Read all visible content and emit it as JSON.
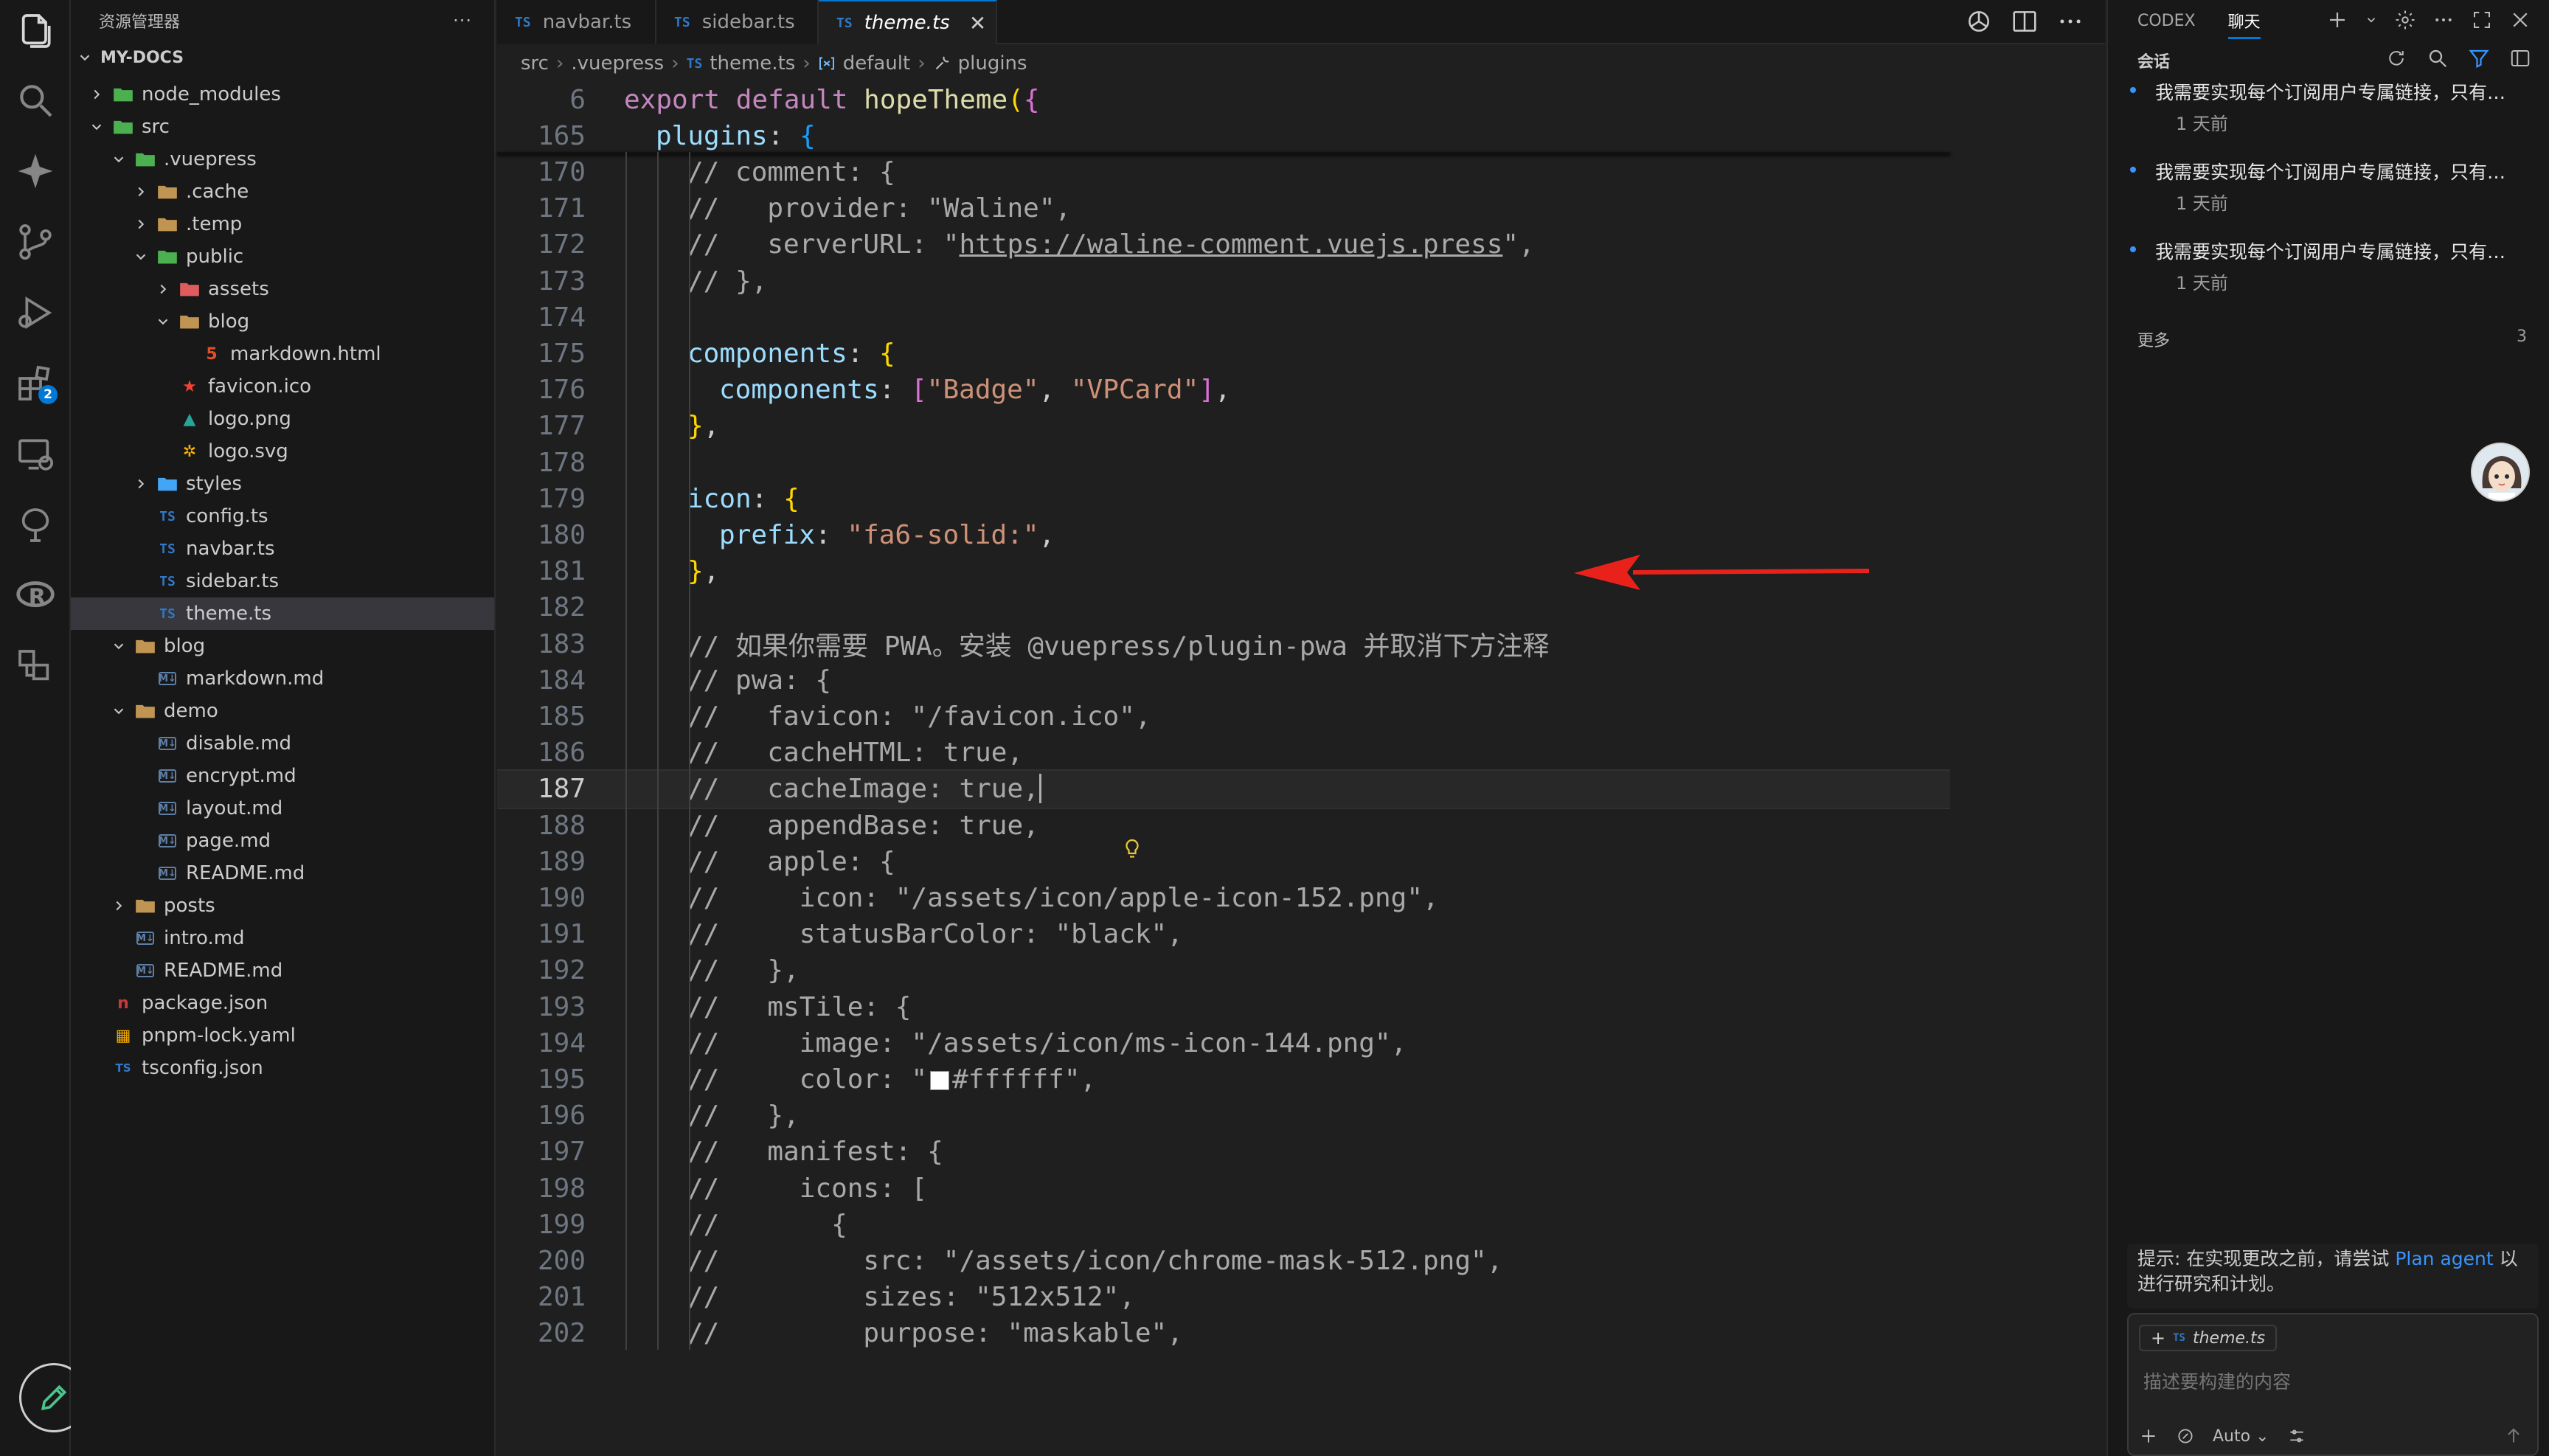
{
  "explorer": {
    "title": "资源管理器",
    "more": "···",
    "root": "MY-DOCS",
    "tree": [
      {
        "label": "node_modules",
        "type": "folder",
        "icon": "folder-green-icon",
        "depth": 0,
        "open": false
      },
      {
        "label": "src",
        "type": "folder",
        "icon": "folder-green-icon",
        "depth": 0,
        "open": true
      },
      {
        "label": ".vuepress",
        "type": "folder",
        "icon": "folder-green-icon",
        "depth": 1,
        "open": true
      },
      {
        "label": ".cache",
        "type": "folder",
        "icon": "folder-icon",
        "depth": 2,
        "open": false
      },
      {
        "label": ".temp",
        "type": "folder",
        "icon": "folder-icon",
        "depth": 2,
        "open": false
      },
      {
        "label": "public",
        "type": "folder",
        "icon": "folder-green-icon",
        "depth": 2,
        "open": true
      },
      {
        "label": "assets",
        "type": "folder",
        "icon": "folder-red-icon",
        "depth": 3,
        "open": false
      },
      {
        "label": "blog",
        "type": "folder",
        "icon": "folder-icon",
        "depth": 3,
        "open": true
      },
      {
        "label": "markdown.html",
        "type": "file",
        "icon": "html5-icon",
        "depth": 4
      },
      {
        "label": "favicon.ico",
        "type": "file",
        "icon": "star-file-icon",
        "depth": 3
      },
      {
        "label": "logo.png",
        "type": "file",
        "icon": "image-file-icon",
        "depth": 3
      },
      {
        "label": "logo.svg",
        "type": "file",
        "icon": "svg-file-icon",
        "depth": 3
      },
      {
        "label": "styles",
        "type": "folder",
        "icon": "folder-blue-icon",
        "depth": 2,
        "open": false
      },
      {
        "label": "config.ts",
        "type": "file",
        "icon": "typescript-icon",
        "depth": 2
      },
      {
        "label": "navbar.ts",
        "type": "file",
        "icon": "typescript-icon",
        "depth": 2
      },
      {
        "label": "sidebar.ts",
        "type": "file",
        "icon": "typescript-icon",
        "depth": 2
      },
      {
        "label": "theme.ts",
        "type": "file",
        "icon": "typescript-icon",
        "depth": 2,
        "selected": true
      },
      {
        "label": "blog",
        "type": "folder",
        "icon": "folder-icon",
        "depth": 1,
        "open": true
      },
      {
        "label": "markdown.md",
        "type": "file",
        "icon": "markdown-icon",
        "depth": 2
      },
      {
        "label": "demo",
        "type": "folder",
        "icon": "folder-icon",
        "depth": 1,
        "open": true
      },
      {
        "label": "disable.md",
        "type": "file",
        "icon": "markdown-icon",
        "depth": 2
      },
      {
        "label": "encrypt.md",
        "type": "file",
        "icon": "markdown-icon",
        "depth": 2
      },
      {
        "label": "layout.md",
        "type": "file",
        "icon": "markdown-icon",
        "depth": 2
      },
      {
        "label": "page.md",
        "type": "file",
        "icon": "markdown-icon",
        "depth": 2
      },
      {
        "label": "README.md",
        "type": "file",
        "icon": "markdown-icon",
        "depth": 2
      },
      {
        "label": "posts",
        "type": "folder",
        "icon": "folder-icon",
        "depth": 1,
        "open": false
      },
      {
        "label": "intro.md",
        "type": "file",
        "icon": "markdown-icon",
        "depth": 1
      },
      {
        "label": "README.md",
        "type": "file",
        "icon": "markdown-icon",
        "depth": 1
      },
      {
        "label": "package.json",
        "type": "file",
        "icon": "npm-icon",
        "depth": 0
      },
      {
        "label": "pnpm-lock.yaml",
        "type": "file",
        "icon": "pnpm-icon",
        "depth": 0
      },
      {
        "label": "tsconfig.json",
        "type": "file",
        "icon": "tsconfig-icon",
        "depth": 0
      }
    ]
  },
  "activity": {
    "items": [
      "files-icon",
      "search-icon",
      "sparkle-icon",
      "source-control-icon",
      "run-debug-icon",
      "extensions-icon",
      "remote-explorer-icon",
      "tree-icon",
      "r-language-icon",
      "containers-icon"
    ],
    "extensions_badge": "2",
    "bottom": "edit-pencil-icon"
  },
  "tabs": [
    {
      "label": "navbar.ts",
      "badge": "TS",
      "active": false
    },
    {
      "label": "sidebar.ts",
      "badge": "TS",
      "active": false
    },
    {
      "label": "theme.ts",
      "badge": "TS",
      "active": true,
      "close": "✕"
    }
  ],
  "breadcrumb": {
    "parts": [
      "src",
      ".vuepress",
      "theme.ts",
      "default",
      "plugins"
    ],
    "ts_badge": "TS",
    "sep": "›"
  },
  "editor": {
    "current_line": "187",
    "lines": [
      {
        "n": "6",
        "indent": 0,
        "sticky": true,
        "segs": [
          [
            "kw",
            "export"
          ],
          [
            "",
            " "
          ],
          [
            "kw",
            "default"
          ],
          [
            "",
            " "
          ],
          [
            "fn",
            "hopeTheme"
          ],
          [
            "br1",
            "("
          ],
          [
            "br2",
            "{"
          ]
        ]
      },
      {
        "n": "165",
        "indent": 1,
        "sticky": true,
        "segs": [
          [
            "pr",
            "plugins"
          ],
          [
            "",
            ": "
          ],
          [
            "br3",
            "{"
          ]
        ]
      },
      {
        "n": "170",
        "indent": 2,
        "segs": [
          [
            "cm",
            "// comment: {"
          ]
        ]
      },
      {
        "n": "171",
        "indent": 2,
        "segs": [
          [
            "cm",
            "//   provider: \"Waline\","
          ]
        ]
      },
      {
        "n": "172",
        "indent": 2,
        "segs": [
          [
            "cm",
            "//   serverURL: \""
          ],
          [
            "cm u",
            "https://waline-comment.vuejs.press"
          ],
          [
            "cm",
            "\","
          ]
        ]
      },
      {
        "n": "173",
        "indent": 2,
        "segs": [
          [
            "cm",
            "// },"
          ]
        ]
      },
      {
        "n": "174",
        "indent": 2,
        "segs": []
      },
      {
        "n": "175",
        "indent": 2,
        "segs": [
          [
            "pr",
            "components"
          ],
          [
            "",
            ": "
          ],
          [
            "br1",
            "{"
          ]
        ]
      },
      {
        "n": "176",
        "indent": 3,
        "segs": [
          [
            "pr",
            "components"
          ],
          [
            "",
            ": "
          ],
          [
            "br2",
            "["
          ],
          [
            "st",
            "\"Badge\""
          ],
          [
            "",
            ", "
          ],
          [
            "st",
            "\"VPCard\""
          ],
          [
            "br2",
            "]"
          ],
          [
            "",
            ","
          ]
        ]
      },
      {
        "n": "177",
        "indent": 2,
        "segs": [
          [
            "br1",
            "}"
          ],
          [
            "",
            ","
          ]
        ]
      },
      {
        "n": "178",
        "indent": 2,
        "segs": []
      },
      {
        "n": "179",
        "indent": 2,
        "segs": [
          [
            "pr",
            "icon"
          ],
          [
            "",
            ": "
          ],
          [
            "br1",
            "{"
          ]
        ]
      },
      {
        "n": "180",
        "indent": 3,
        "segs": [
          [
            "pr",
            "prefix"
          ],
          [
            "",
            ": "
          ],
          [
            "st",
            "\"fa6-solid:\""
          ],
          [
            "",
            ","
          ]
        ]
      },
      {
        "n": "181",
        "indent": 2,
        "segs": [
          [
            "br1",
            "}"
          ],
          [
            "",
            ","
          ]
        ]
      },
      {
        "n": "182",
        "indent": 2,
        "segs": []
      },
      {
        "n": "183",
        "indent": 2,
        "segs": [
          [
            "cm",
            "// 如果你需要 PWA。安装 @vuepress/plugin-pwa 并取消下方注释"
          ]
        ]
      },
      {
        "n": "184",
        "indent": 2,
        "segs": [
          [
            "cm",
            "// pwa: {"
          ]
        ]
      },
      {
        "n": "185",
        "indent": 2,
        "segs": [
          [
            "cm",
            "//   favicon: \"/favicon.ico\","
          ]
        ]
      },
      {
        "n": "186",
        "indent": 2,
        "segs": [
          [
            "cm",
            "//   cacheHTML: true,"
          ]
        ]
      },
      {
        "n": "187",
        "indent": 2,
        "segs": [
          [
            "cm",
            "//   cacheImage: true,"
          ]
        ]
      },
      {
        "n": "188",
        "indent": 2,
        "segs": [
          [
            "cm",
            "//   appendBase: true,"
          ]
        ]
      },
      {
        "n": "189",
        "indent": 2,
        "segs": [
          [
            "cm",
            "//   apple: {"
          ]
        ]
      },
      {
        "n": "190",
        "indent": 2,
        "segs": [
          [
            "cm",
            "//     icon: \"/assets/icon/apple-icon-152.png\","
          ]
        ]
      },
      {
        "n": "191",
        "indent": 2,
        "segs": [
          [
            "cm",
            "//     statusBarColor: \"black\","
          ]
        ]
      },
      {
        "n": "192",
        "indent": 2,
        "segs": [
          [
            "cm",
            "//   },"
          ]
        ]
      },
      {
        "n": "193",
        "indent": 2,
        "segs": [
          [
            "cm",
            "//   msTile: {"
          ]
        ]
      },
      {
        "n": "194",
        "indent": 2,
        "segs": [
          [
            "cm",
            "//     image: \"/assets/icon/ms-icon-144.png\","
          ]
        ]
      },
      {
        "n": "195",
        "indent": 2,
        "segs": [
          [
            "cm",
            "//     color: \""
          ],
          [
            "swatch",
            ""
          ],
          [
            "cm",
            "#ffffff\","
          ]
        ]
      },
      {
        "n": "196",
        "indent": 2,
        "segs": [
          [
            "cm",
            "//   },"
          ]
        ]
      },
      {
        "n": "197",
        "indent": 2,
        "segs": [
          [
            "cm",
            "//   manifest: {"
          ]
        ]
      },
      {
        "n": "198",
        "indent": 2,
        "segs": [
          [
            "cm",
            "//     icons: ["
          ]
        ]
      },
      {
        "n": "199",
        "indent": 2,
        "segs": [
          [
            "cm",
            "//       {"
          ]
        ]
      },
      {
        "n": "200",
        "indent": 2,
        "segs": [
          [
            "cm",
            "//         src: \"/assets/icon/chrome-mask-512.png\","
          ]
        ]
      },
      {
        "n": "201",
        "indent": 2,
        "segs": [
          [
            "cm",
            "//         sizes: \"512x512\","
          ]
        ]
      },
      {
        "n": "202",
        "indent": 2,
        "segs": [
          [
            "cm",
            "//         purpose: \"maskable\","
          ]
        ]
      }
    ]
  },
  "chat": {
    "tabs": [
      {
        "label": "CODEX",
        "active": false
      },
      {
        "label": "聊天",
        "active": true
      }
    ],
    "actions": [
      "plus-icon",
      "chevron-down-icon",
      "gear-icon",
      "more-icon",
      "maximize-icon",
      "close-icon"
    ],
    "sessions_title": "会话",
    "session_tools": [
      "refresh-icon",
      "search-icon",
      "filter-icon",
      "panel-icon"
    ],
    "sessions": [
      {
        "title": "我需要实现每个订阅用户专属链接，只有…",
        "time": "1 天前"
      },
      {
        "title": "我需要实现每个订阅用户专属链接，只有…",
        "time": "1 天前"
      },
      {
        "title": "我需要实现每个订阅用户专属链接，只有…",
        "time": "1 天前"
      }
    ],
    "more_label": "更多",
    "more_count": "3",
    "tip_prefix": "提示: 在实现更改之前，请尝试 ",
    "tip_link": "Plan agent",
    "tip_suffix": " 以进行研究和计划。",
    "context_chip": "theme.ts",
    "context_chip_badge": "TS",
    "context_plus": "+",
    "input_placeholder": "描述要构建的内容",
    "mode": "Auto",
    "mode_caret": "⌄"
  },
  "colors": {
    "accent": "#0078d4",
    "arrow": "#e8221b",
    "link": "#3794ff"
  }
}
